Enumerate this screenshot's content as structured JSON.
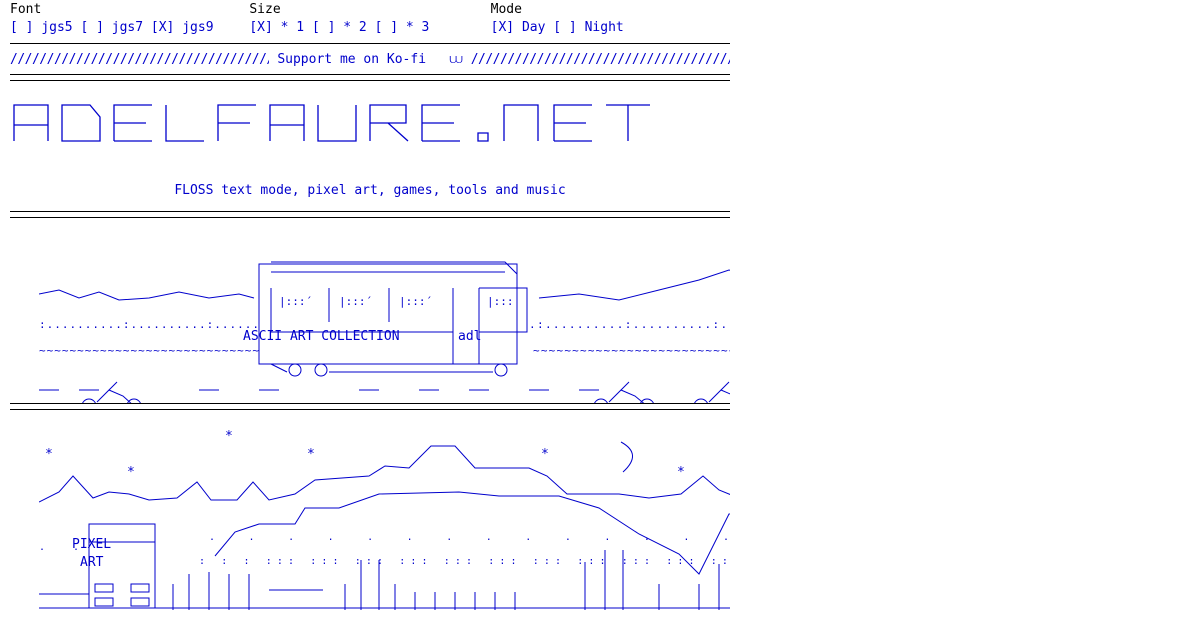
{
  "options": {
    "font": {
      "label": "Font",
      "choices": [
        {
          "mark": "[ ]",
          "name": "jgs5"
        },
        {
          "mark": "[ ]",
          "name": "jgs7"
        },
        {
          "mark": "[X]",
          "name": "jgs9"
        }
      ]
    },
    "size": {
      "label": "Size",
      "choices": [
        {
          "mark": "[X]",
          "name": "* 1"
        },
        {
          "mark": "[ ]",
          "name": "* 2"
        },
        {
          "mark": "[ ]",
          "name": "* 3"
        }
      ]
    },
    "mode": {
      "label": "Mode",
      "choices": [
        {
          "mark": "[X]",
          "name": "Day"
        },
        {
          "mark": "[ ]",
          "name": "Night"
        }
      ]
    }
  },
  "support": {
    "filler": "////////////////////////////////////////////////",
    "text": "Support me on Ko-fi",
    "icon": "cup-icon"
  },
  "logo": {
    "text": "ADELFAURE.NET"
  },
  "tagline": "FLOSS text mode, pixel art, games, tools and music",
  "ascii_section": {
    "title": "ASCII ART COLLECTION",
    "tag": "adl"
  },
  "pixel_section": {
    "title_line1": "PIXEL",
    "title_line2": "ART"
  },
  "colors": {
    "accent": "#0000cc",
    "rule": "#000000",
    "background": "#ffffff"
  }
}
